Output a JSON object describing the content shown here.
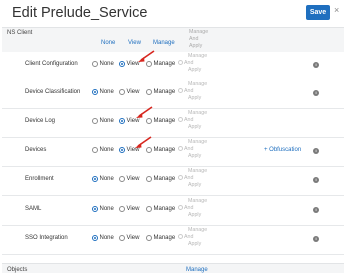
{
  "dialog": {
    "title": "Edit Prelude_Service",
    "save_label": "Save",
    "close_glyph": "×"
  },
  "section_header": {
    "label": "NS Client",
    "none": "None",
    "view": "View",
    "manage": "Manage",
    "manage_and": "And",
    "manage_apply": "Apply"
  },
  "radio_labels": {
    "none": "None",
    "view": "View",
    "manage": "Manage"
  },
  "disabled_manage": {
    "line1": "Manage",
    "line2": "And",
    "line3": "Apply"
  },
  "rows": [
    {
      "label": "Client Configuration",
      "selected": "view",
      "info": true,
      "extra": ""
    },
    {
      "label": "Device Classification",
      "selected": "none",
      "info": true,
      "extra": ""
    },
    {
      "label": "Device Log",
      "selected": "view",
      "info": false,
      "extra": ""
    },
    {
      "label": "Devices",
      "selected": "view",
      "info": true,
      "extra": "+ Obfuscation"
    },
    {
      "label": "Enrollment",
      "selected": "none",
      "info": true,
      "extra": ""
    },
    {
      "label": "SAML",
      "selected": "none",
      "info": true,
      "extra": ""
    },
    {
      "label": "SSO Integration",
      "selected": "none",
      "info": true,
      "extra": ""
    }
  ],
  "objects": {
    "label": "Objects",
    "manage": "Manage"
  },
  "icons": {
    "info": "info-icon",
    "close": "close-icon",
    "annotation": "red-arrow-icon"
  },
  "colors": {
    "accent": "#1f6fbf",
    "annotation": "#d7261e"
  }
}
